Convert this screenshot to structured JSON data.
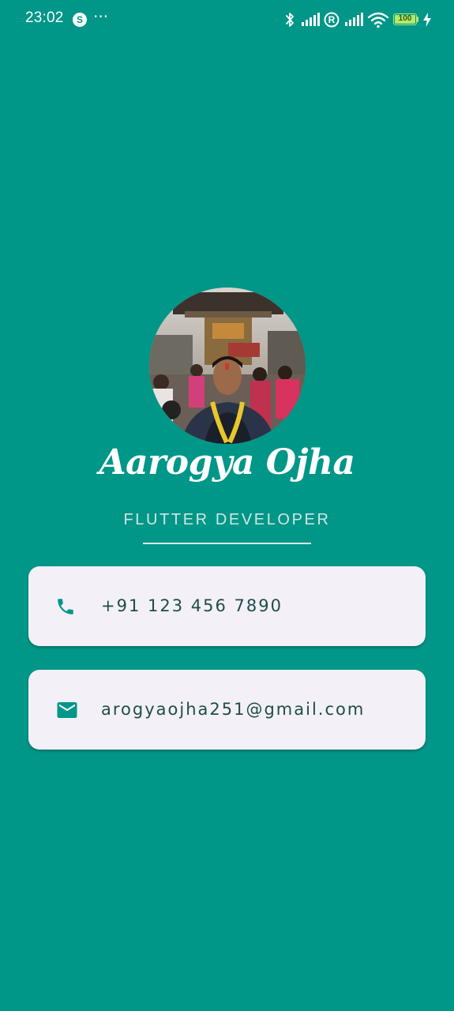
{
  "status_bar": {
    "time": "23:02",
    "notification_badge": "S",
    "more": "···",
    "sim_badge": "R",
    "battery_level": "100",
    "icons": [
      "bluetooth-icon",
      "signal-icon",
      "roaming-icon",
      "signal-icon",
      "wifi-icon",
      "battery-icon",
      "charging-bolt-icon"
    ]
  },
  "profile": {
    "name": "Aarogya Ojha",
    "title": "FLUTTER DEVELOPER"
  },
  "contacts": {
    "phone": {
      "icon": "phone-icon",
      "value": "+91 123 456 7890"
    },
    "email": {
      "icon": "mail-icon",
      "value": "arogyaojha251@gmail.com"
    }
  },
  "colors": {
    "background": "#009688",
    "card": "#f3f0f7",
    "accent": "#009688",
    "text_dark": "#1f4d49",
    "battery": "#b3e86b"
  }
}
